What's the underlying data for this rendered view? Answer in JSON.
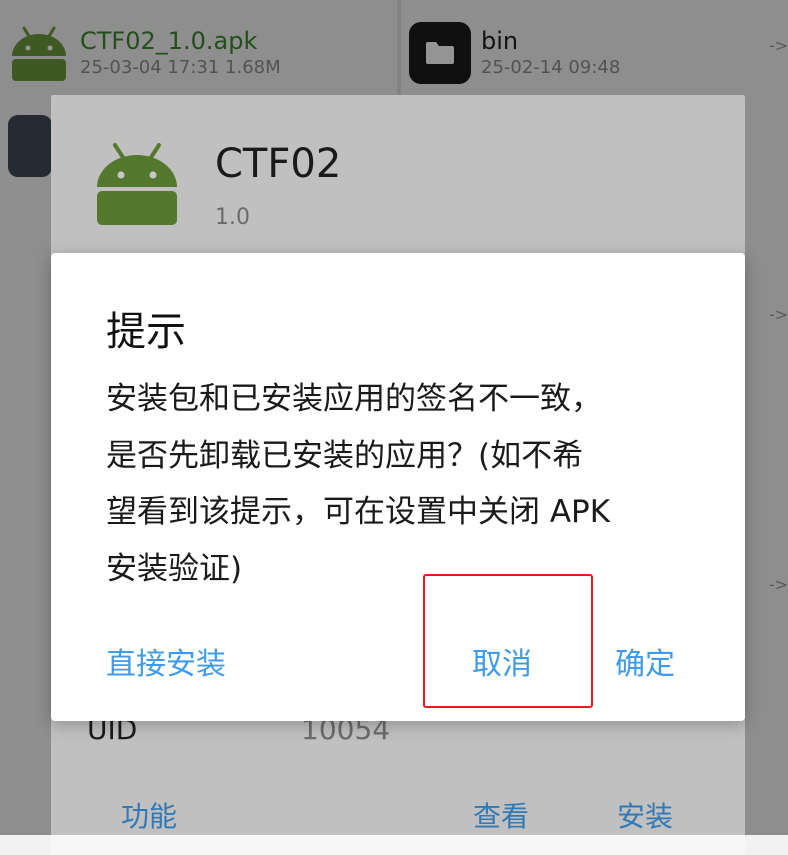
{
  "file_manager": {
    "left_file": {
      "name": "CTF02_1.0.apk",
      "meta": "25-03-04 17:31  1.68M"
    },
    "right_file": {
      "name": "bin",
      "meta": "25-02-14 09:48"
    },
    "hint_glyph": "->"
  },
  "apk_info": {
    "app_name": "CTF02",
    "version": "1.0",
    "uid_label": "UID",
    "uid_value": "10054",
    "actions": {
      "function": "功能",
      "view": "查看",
      "install": "安装"
    }
  },
  "alert": {
    "title": "提示",
    "message_lines": [
      "安装包和已安装应用的签名不一致，",
      "是否先卸载已安装的应用？(如不希",
      "望看到该提示，可在设置中关闭 APK",
      "安装验证)"
    ],
    "buttons": {
      "direct_install": "直接安装",
      "cancel": "取消",
      "confirm": "确定"
    }
  },
  "colors": {
    "accent": "#3f9be8",
    "android_green": "#6b9a3b",
    "apk_name_green": "#3c8a2e",
    "highlight_red": "#e31d1d"
  }
}
